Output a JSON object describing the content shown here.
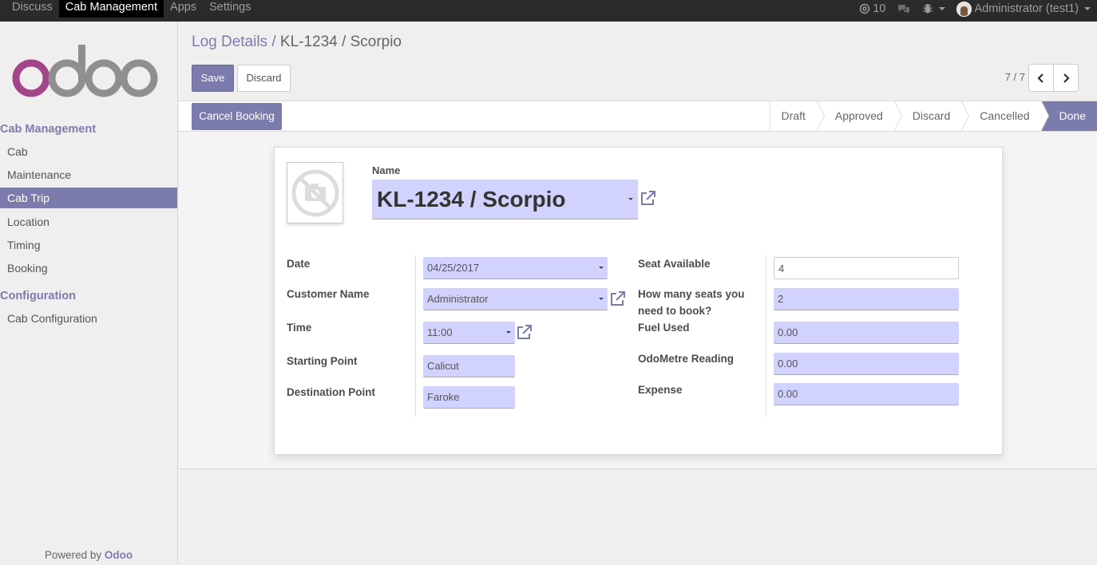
{
  "topbar": {
    "menu": [
      "Discuss",
      "Cab Management",
      "Apps",
      "Settings"
    ],
    "active_menu": "Cab Management",
    "notifications_count": "10",
    "user": "Administrator (test1)"
  },
  "sidebar": {
    "section1": "Cab Management",
    "items1": [
      "Cab",
      "Maintenance",
      "Cab Trip",
      "Location",
      "Timing",
      "Booking"
    ],
    "active_item": "Cab Trip",
    "section2": "Configuration",
    "items2": [
      "Cab Configuration"
    ],
    "powered_by": "Powered by",
    "powered_brand": "Odoo"
  },
  "control": {
    "breadcrumb_parent": "Log Details",
    "breadcrumb_sep": " / ",
    "breadcrumb_current": "KL-1234 / Scorpio",
    "save_label": "Save",
    "discard_label": "Discard",
    "pager": "7 / 7"
  },
  "statusbar": {
    "cancel_label": "Cancel Booking",
    "stages": [
      "Draft",
      "Approved",
      "Discard",
      "Cancelled",
      "Done"
    ],
    "current_stage": "Done"
  },
  "form": {
    "name_label": "Name",
    "name_value": "KL-1234 / Scorpio",
    "date_label": "Date",
    "date_value": "04/25/2017",
    "customer_label": "Customer Name",
    "customer_value": "Administrator",
    "time_label": "Time",
    "time_value": "11:00",
    "start_label": "Starting Point",
    "start_value": "Calicut",
    "dest_label": "Destination Point",
    "dest_value": "Faroke",
    "seat_label": "Seat Available",
    "seat_value": "4",
    "seats_book_label_1": "How many seats you",
    "seats_book_label_2": "need to book?",
    "seats_book_value": "2",
    "fuel_label": "Fuel Used",
    "fuel_value": "0.00",
    "odo_label": "OdoMetre Reading",
    "odo_value": "0.00",
    "expense_label": "Expense",
    "expense_value": "0.00"
  },
  "colors": {
    "brand": "#7c7bad",
    "field_bg": "#d2d2ff",
    "topbar_bg": "#2b2b2b"
  }
}
